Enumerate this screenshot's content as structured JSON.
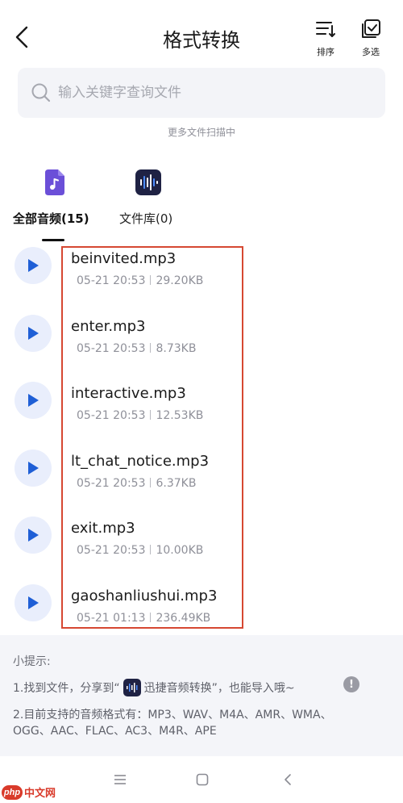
{
  "header": {
    "title": "格式转换",
    "sort_label": "排序",
    "multi_label": "多选"
  },
  "search": {
    "placeholder": "输入关键字查询文件"
  },
  "scan_status": "更多文件扫描中",
  "tabs": [
    {
      "label": "全部音频(15)",
      "icon": "music-file-icon",
      "active": true
    },
    {
      "label": "文件库(0)",
      "icon": "audio-wave-icon",
      "active": false
    }
  ],
  "files": [
    {
      "name": "beinvited.mp3",
      "date": "05-21 20:53",
      "size": "29.20KB"
    },
    {
      "name": "enter.mp3",
      "date": "05-21 20:53",
      "size": "8.73KB"
    },
    {
      "name": "interactive.mp3",
      "date": "05-21 20:53",
      "size": "12.53KB"
    },
    {
      "name": "lt_chat_notice.mp3",
      "date": "05-21 20:53",
      "size": "6.37KB"
    },
    {
      "name": "exit.mp3",
      "date": "05-21 20:53",
      "size": "10.00KB"
    },
    {
      "name": "gaoshanliushui.mp3",
      "date": "05-21 01:13",
      "size": "236.49KB"
    }
  ],
  "tips": {
    "title": "小提示:",
    "line1_prefix": "1.找到文件，分享到“",
    "line1_app": "迅捷音频转换",
    "line1_suffix": "”，也能导入哦~",
    "info_mark": "!",
    "line2": "2.目前支持的音频格式有：MP3、WAV、M4A、AMR、WMA、OGG、AAC、FLAC、AC3、M4R、APE"
  },
  "watermark": {
    "badge": "php",
    "text": "中文网"
  },
  "colors": {
    "accent": "#1f5fd6",
    "highlight_border": "#d64832",
    "play_bg": "#e9eefc",
    "tab_icon_purple": "#6b4fd8",
    "app_icon_dark": "#1f2244"
  }
}
